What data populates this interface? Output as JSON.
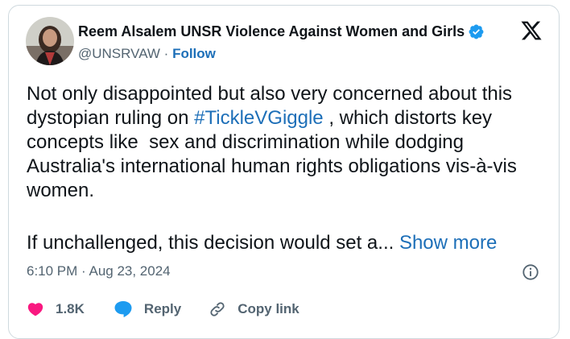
{
  "author": {
    "display_name": "Reem Alsalem UNSR Violence Against Women and Girls",
    "handle": "@UNSRVAW",
    "separator": " · ",
    "follow_label": "Follow",
    "verified": true
  },
  "platform_logo": "x-logo",
  "tweet": {
    "text_before": "Not only disappointed but also very concerned about this dystopian ruling on ",
    "hashtag": "#TickleVGiggle",
    "text_after": " , which distorts key concepts like  sex and discrimination while dodging Australia's international human rights obligations vis-à-vis women.",
    "para2": "If unchallenged, this decision would set a...",
    "show_more": "Show more"
  },
  "timestamp": "6:10 PM · Aug 23, 2024",
  "actions": {
    "like_count": "1.8K",
    "reply_label": "Reply",
    "copy_link_label": "Copy link"
  },
  "colors": {
    "link": "#1d6fb8",
    "like": "#f91880",
    "reply": "#1d9bf0",
    "verified": "#1d9bf0"
  }
}
